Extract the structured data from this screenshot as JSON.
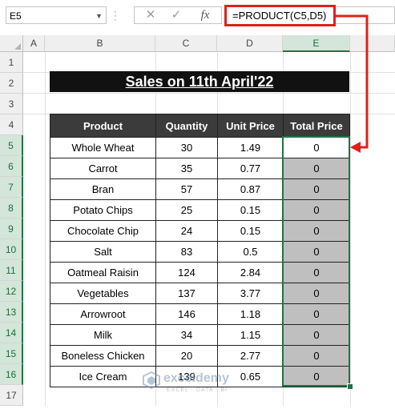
{
  "formula_bar": {
    "name_box": "E5",
    "cancel_icon": "✕",
    "enter_icon": "✓",
    "fx_label": "fx",
    "formula": "=PRODUCT(C5,D5)"
  },
  "columns": [
    "A",
    "B",
    "C",
    "D",
    "E"
  ],
  "rows": [
    "1",
    "2",
    "3",
    "4",
    "5",
    "6",
    "7",
    "8",
    "9",
    "10",
    "11",
    "12",
    "13",
    "14",
    "15",
    "16",
    "17"
  ],
  "title": "Sales on 11th April'22",
  "table": {
    "headers": [
      "Product",
      "Quantity",
      "Unit Price",
      "Total Price"
    ],
    "rows": [
      {
        "product": "Whole Wheat",
        "quantity": "30",
        "unit_price": "1.49",
        "total": "0"
      },
      {
        "product": "Carrot",
        "quantity": "35",
        "unit_price": "0.77",
        "total": "0"
      },
      {
        "product": "Bran",
        "quantity": "57",
        "unit_price": "0.87",
        "total": "0"
      },
      {
        "product": "Potato Chips",
        "quantity": "25",
        "unit_price": "0.15",
        "total": "0"
      },
      {
        "product": "Chocolate Chip",
        "quantity": "24",
        "unit_price": "0.15",
        "total": "0"
      },
      {
        "product": "Salt",
        "quantity": "83",
        "unit_price": "0.5",
        "total": "0"
      },
      {
        "product": "Oatmeal Raisin",
        "quantity": "124",
        "unit_price": "2.84",
        "total": "0"
      },
      {
        "product": "Vegetables",
        "quantity": "137",
        "unit_price": "3.77",
        "total": "0"
      },
      {
        "product": "Arrowroot",
        "quantity": "146",
        "unit_price": "1.18",
        "total": "0"
      },
      {
        "product": "Milk",
        "quantity": "34",
        "unit_price": "1.15",
        "total": "0"
      },
      {
        "product": "Boneless Chicken",
        "quantity": "20",
        "unit_price": "2.77",
        "total": "0"
      },
      {
        "product": "Ice Cream",
        "quantity": "139",
        "unit_price": "0.65",
        "total": "0"
      }
    ]
  },
  "watermark": {
    "name": "exceldemy",
    "tagline": "EXCEL · DATA · BI"
  },
  "colors": {
    "accent": "#217346",
    "highlight": "#e0201b",
    "header_bg": "#3b3b3b",
    "title_bg": "#111111",
    "total_fill": "#bfbfbf"
  }
}
